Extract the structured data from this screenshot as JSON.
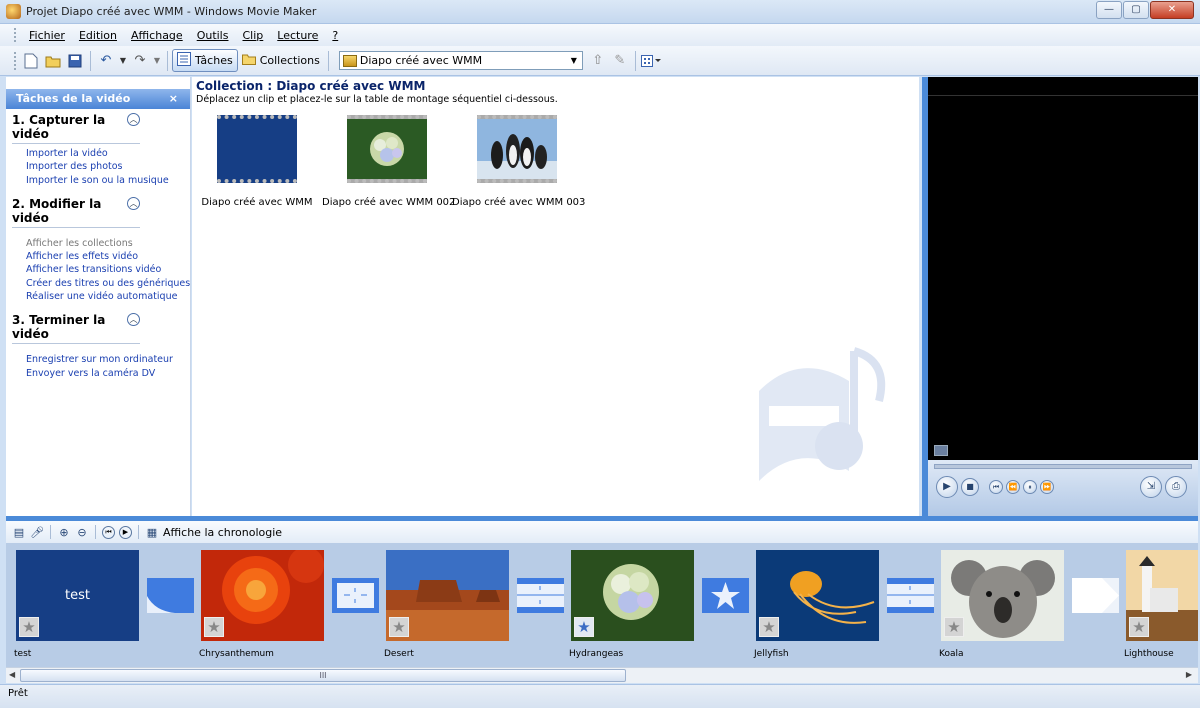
{
  "window": {
    "title": "Projet Diapo créé avec WMM - Windows Movie Maker",
    "controls": [
      "—",
      "▢",
      "✕"
    ]
  },
  "menu": [
    "Fichier",
    "Edition",
    "Affichage",
    "Outils",
    "Clip",
    "Lecture",
    "?"
  ],
  "toolbar": {
    "tasks_label": "Tâches",
    "collections_label": "Collections",
    "collection_selected": "Diapo créé avec WMM"
  },
  "tasks": {
    "header": "Tâches de la vidéo",
    "close": "×",
    "sections": [
      {
        "title": "1. Capturer la vidéo",
        "links": [
          {
            "label": "Importer la vidéo",
            "enabled": true
          },
          {
            "label": "Importer des photos",
            "enabled": true
          },
          {
            "label": "Importer le son ou la musique",
            "enabled": true
          }
        ]
      },
      {
        "title": "2. Modifier la vidéo",
        "links": [
          {
            "label": "Afficher les collections",
            "enabled": false
          },
          {
            "label": "Afficher les effets vidéo",
            "enabled": true
          },
          {
            "label": "Afficher les transitions vidéo",
            "enabled": true
          },
          {
            "label": "Créer des titres ou des génériques",
            "enabled": true
          },
          {
            "label": "Réaliser une vidéo automatique",
            "enabled": true
          }
        ]
      },
      {
        "title": "3. Terminer la vidéo",
        "links": [
          {
            "label": "Enregistrer sur mon ordinateur",
            "enabled": true
          },
          {
            "label": "Envoyer vers la caméra DV",
            "enabled": true
          }
        ]
      }
    ]
  },
  "collection": {
    "title": "Collection : Diapo créé avec WMM",
    "subtitle": "Déplacez un clip et placez-le sur la table de montage séquentiel ci-dessous.",
    "items": [
      {
        "name": "Diapo créé avec WMM",
        "thumb": "blue"
      },
      {
        "name": "Diapo créé avec WMM 002",
        "thumb": "hydrangea"
      },
      {
        "name": "Diapo créé avec WMM 003",
        "thumb": "penguins"
      }
    ]
  },
  "storyboard_bar": {
    "label": "Affiche la chronologie"
  },
  "storyboard": {
    "clips": [
      {
        "label": "test",
        "overlay_text": "test",
        "kind": "title",
        "star": "gray"
      },
      {
        "label": "Chrysanthemum",
        "kind": "chrysanthemum",
        "star": "gray"
      },
      {
        "label": "Desert",
        "kind": "desert",
        "star": "gray"
      },
      {
        "label": "Hydrangeas",
        "kind": "hydrangeas",
        "star": "blue"
      },
      {
        "label": "Jellyfish",
        "kind": "jellyfish",
        "star": "gray"
      },
      {
        "label": "Koala",
        "kind": "koala",
        "star": "gray"
      },
      {
        "label": "Lighthouse",
        "kind": "lighthouse",
        "star": "gray"
      }
    ]
  },
  "scrollbar": {
    "thumb_grip": "III"
  },
  "status": "Prêt"
}
